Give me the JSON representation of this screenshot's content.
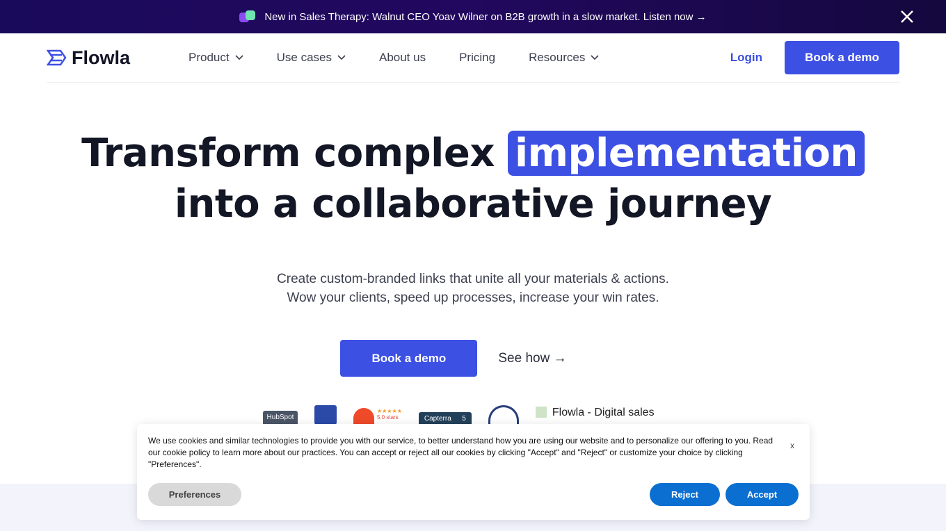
{
  "announcement": {
    "text": "New in Sales Therapy: Walnut CEO Yoav Wilner on B2B growth in a slow market. Listen now →",
    "icon": "podcast-icon",
    "close_icon": "close-icon"
  },
  "nav": {
    "logo": "Flowla",
    "items": [
      {
        "label": "Product",
        "dropdown": true
      },
      {
        "label": "Use cases",
        "dropdown": true
      },
      {
        "label": "About us",
        "dropdown": false
      },
      {
        "label": "Pricing",
        "dropdown": false
      },
      {
        "label": "Resources",
        "dropdown": true
      }
    ],
    "login": "Login",
    "cta": "Book a demo"
  },
  "hero": {
    "title_pre": "Transform complex",
    "title_highlight": "implementation",
    "title_line2": "into a collaborative journey",
    "sub1": "Create custom-branded links that unite all your materials & actions.",
    "sub2": "Wow your clients, speed up processes, increase your win rates.",
    "cta_primary": "Book a demo",
    "cta_secondary": "See how →"
  },
  "badges": {
    "hubspot": "HubSpot",
    "g2_rating": "5.0 stars",
    "capterra": "Capterra",
    "capterra_score": "5",
    "broken_image_alt": "Flowla - Digital sales"
  },
  "cookie": {
    "text": "We use cookies and similar technologies to provide you with our service, to better understand how you are using our website and to personalize our offering to you. Read our cookie policy to learn more about our practices. You can accept or reject all our cookies by clicking \"Accept\" and \"Reject\" or customize your choice by clicking \"Preferences\".",
    "close": "x",
    "preferences": "Preferences",
    "reject": "Reject",
    "accept": "Accept"
  },
  "colors": {
    "accent": "#3d50e4",
    "cookie_button": "#0a6fd1",
    "banner_bg": "#1a0a5c"
  }
}
